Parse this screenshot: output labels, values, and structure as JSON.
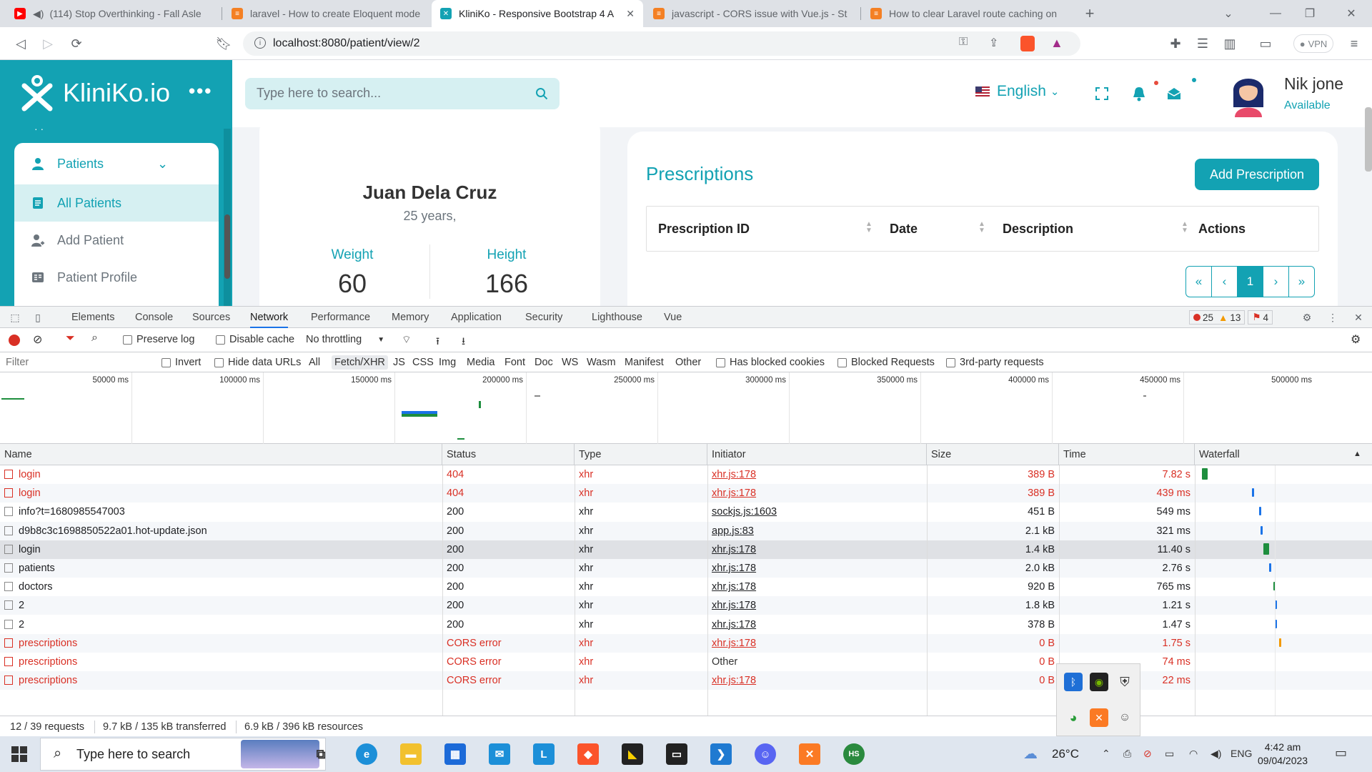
{
  "browser": {
    "tabs": [
      {
        "title": "(114) Stop Overthinking - Fall Asle",
        "icon": "youtube-icon",
        "color": "#ff0000"
      },
      {
        "title": "laravel - How to create Eloquent mode",
        "icon": "stackoverflow-icon",
        "color": "#f48024"
      },
      {
        "title": "KliniKo - Responsive Bootstrap 4 A",
        "icon": "kliniko-icon",
        "color": "#13a2b3"
      },
      {
        "title": "javascript - CORS issue with Vue.js - St",
        "icon": "stackoverflow-icon",
        "color": "#f48024"
      },
      {
        "title": "How to clear Laravel route caching on",
        "icon": "stackoverflow-icon",
        "color": "#f48024"
      }
    ],
    "new_tab": "+",
    "url": "localhost:8080/patient/view/2",
    "vpn_label": "VPN"
  },
  "app": {
    "brand": "KliniKo.io",
    "search_placeholder": "Type here to search...",
    "language": "English",
    "user": {
      "name": "Nik jone",
      "status": "Available"
    },
    "sidebar": {
      "group": "Patients",
      "items": [
        {
          "label": "All Patients"
        },
        {
          "label": "Add Patient"
        },
        {
          "label": "Patient Profile"
        }
      ]
    },
    "patient": {
      "name": "Juan Dela Cruz",
      "age": "25 years,",
      "weight_label": "Weight",
      "weight": "60",
      "height_label": "Height",
      "height": "166"
    },
    "prescriptions": {
      "title": "Prescriptions",
      "add_button": "Add Prescription",
      "columns": [
        "Prescription ID",
        "Date",
        "Description",
        "Actions"
      ],
      "pager": [
        "«",
        "‹",
        "1",
        "›",
        "»"
      ]
    },
    "colors": {
      "accent": "#13a2b3",
      "accent_light": "#d6f0f2"
    }
  },
  "devtools": {
    "tabs": [
      "Elements",
      "Console",
      "Sources",
      "Network",
      "Performance",
      "Memory",
      "Application",
      "Security",
      "Lighthouse",
      "Vue"
    ],
    "active_tab": "Network",
    "badges": {
      "errors": "25",
      "warnings": "13",
      "issues": "4"
    },
    "toolbar": {
      "preserve_log": "Preserve log",
      "disable_cache": "Disable cache",
      "throttling": "No throttling"
    },
    "filter": {
      "placeholder": "Filter",
      "invert": "Invert",
      "hide_data_urls": "Hide data URLs",
      "types": [
        "All",
        "Fetch/XHR",
        "JS",
        "CSS",
        "Img",
        "Media",
        "Font",
        "Doc",
        "WS",
        "Wasm",
        "Manifest",
        "Other"
      ],
      "selected_type": "Fetch/XHR",
      "has_blocked_cookies": "Has blocked cookies",
      "blocked_requests": "Blocked Requests",
      "third_party": "3rd-party requests"
    },
    "timeline_ticks": [
      "50000 ms",
      "100000 ms",
      "150000 ms",
      "200000 ms",
      "250000 ms",
      "300000 ms",
      "350000 ms",
      "400000 ms",
      "450000 ms",
      "500000 ms"
    ],
    "columns": [
      "Name",
      "Status",
      "Type",
      "Initiator",
      "Size",
      "Time",
      "Waterfall"
    ],
    "requests": [
      {
        "name": "login",
        "status": "404",
        "type": "xhr",
        "initiator": "xhr.js:178",
        "size": "389 B",
        "time": "7.82 s",
        "error": true
      },
      {
        "name": "login",
        "status": "404",
        "type": "xhr",
        "initiator": "xhr.js:178",
        "size": "389 B",
        "time": "439 ms",
        "error": true
      },
      {
        "name": "info?t=1680985547003",
        "status": "200",
        "type": "xhr",
        "initiator": "sockjs.js:1603",
        "size": "451 B",
        "time": "549 ms",
        "error": false
      },
      {
        "name": "d9b8c3c1698850522a01.hot-update.json",
        "status": "200",
        "type": "xhr",
        "initiator": "app.js:83",
        "size": "2.1 kB",
        "time": "321 ms",
        "error": false
      },
      {
        "name": "login",
        "status": "200",
        "type": "xhr",
        "initiator": "xhr.js:178",
        "size": "1.4 kB",
        "time": "11.40 s",
        "error": false
      },
      {
        "name": "patients",
        "status": "200",
        "type": "xhr",
        "initiator": "xhr.js:178",
        "size": "2.0 kB",
        "time": "2.76 s",
        "error": false
      },
      {
        "name": "doctors",
        "status": "200",
        "type": "xhr",
        "initiator": "xhr.js:178",
        "size": "920 B",
        "time": "765 ms",
        "error": false
      },
      {
        "name": "2",
        "status": "200",
        "type": "xhr",
        "initiator": "xhr.js:178",
        "size": "1.8 kB",
        "time": "1.21 s",
        "error": false
      },
      {
        "name": "2",
        "status": "200",
        "type": "xhr",
        "initiator": "xhr.js:178",
        "size": "378 B",
        "time": "1.47 s",
        "error": false
      },
      {
        "name": "prescriptions",
        "status": "CORS error",
        "type": "xhr",
        "initiator": "xhr.js:178",
        "size": "0 B",
        "time": "1.75 s",
        "error": true
      },
      {
        "name": "prescriptions",
        "status": "CORS error",
        "type": "xhr",
        "initiator": "Other",
        "size": "0 B",
        "time": "74 ms",
        "error": true
      },
      {
        "name": "prescriptions",
        "status": "CORS error",
        "type": "xhr",
        "initiator": "xhr.js:178",
        "size": "0 B",
        "time": "22 ms",
        "error": true
      }
    ],
    "summary": {
      "requests": "12 / 39 requests",
      "transferred": "9.7 kB / 135 kB transferred",
      "resources": "6.9 kB / 396 kB resources"
    }
  },
  "taskbar": {
    "search_placeholder": "Type here to search",
    "weather": "26°C",
    "language": "ENG",
    "time": "4:42 am",
    "date": "09/04/2023"
  }
}
